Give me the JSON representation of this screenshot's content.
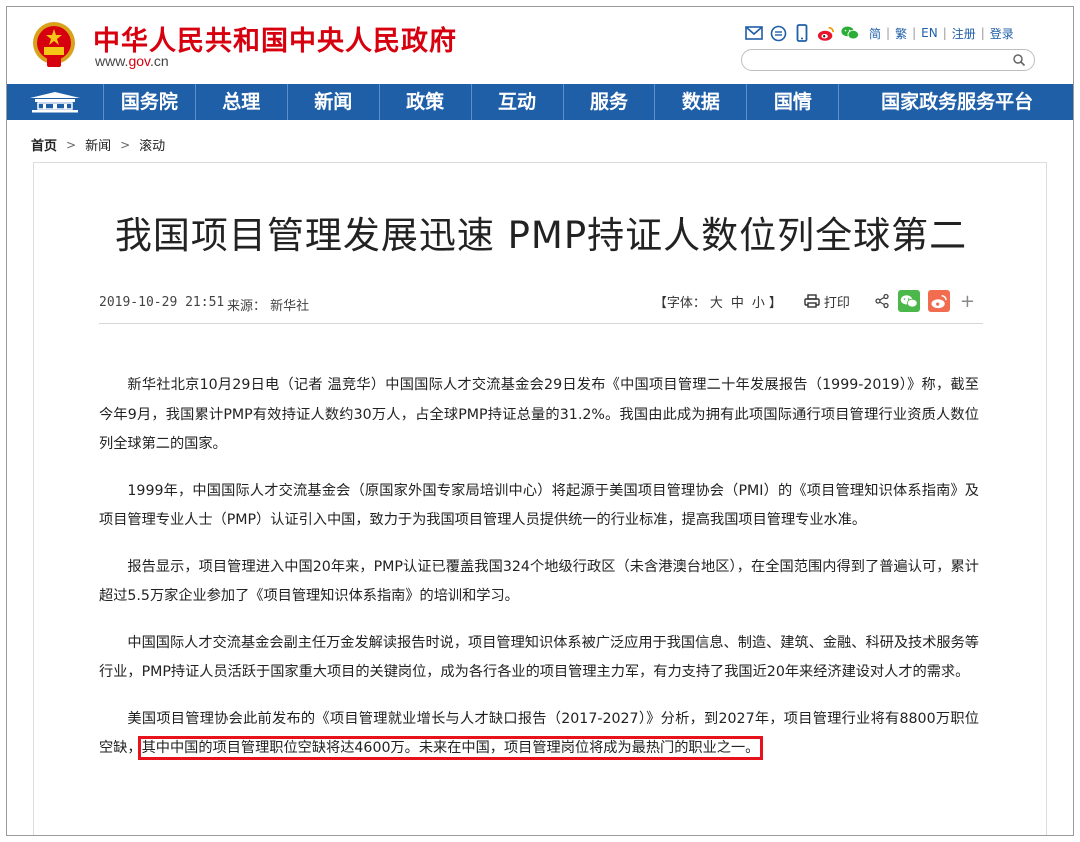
{
  "header": {
    "site_title": "中华人民共和国中央人民政府",
    "site_url_prefix": "www.",
    "site_url_gov": "gov",
    "site_url_suffix": ".cn",
    "top_links": [
      "简",
      "繁",
      "EN",
      "注册",
      "登录"
    ],
    "top_icons": [
      "mail-icon",
      "chat-icon",
      "mobile-icon",
      "weibo-icon",
      "wechat-icon"
    ],
    "search_placeholder": ""
  },
  "nav": {
    "items": [
      "国务院",
      "总理",
      "新闻",
      "政策",
      "互动",
      "服务",
      "数据",
      "国情",
      "国家政务服务平台"
    ]
  },
  "breadcrumb": {
    "home": "首页",
    "items": [
      "新闻",
      "滚动"
    ]
  },
  "article": {
    "title": "我国项目管理发展迅速 PMP持证人数位列全球第二",
    "date": "2019-10-29 21:51",
    "source": "来源： 新华社",
    "font_label_open": "【字体：",
    "font_large": "大",
    "font_medium": "中",
    "font_small": "小",
    "font_label_close": "】",
    "print_label": "打印",
    "paragraphs": [
      "新华社北京10月29日电（记者 温竞华）中国国际人才交流基金会29日发布《中国项目管理二十年发展报告（1999-2019）》称，截至今年9月，我国累计PMP有效持证人数约30万人，占全球PMP持证总量的31.2%。我国由此成为拥有此项国际通行项目管理行业资质人数位列全球第二的国家。",
      "1999年，中国国际人才交流基金会（原国家外国专家局培训中心）将起源于美国项目管理协会（PMI）的《项目管理知识体系指南》及项目管理专业人士（PMP）认证引入中国，致力于为我国项目管理人员提供统一的行业标准，提高我国项目管理专业水准。",
      "报告显示，项目管理进入中国20年来，PMP认证已覆盖我国324个地级行政区（未含港澳台地区），在全国范围内得到了普遍认可，累计超过5.5万家企业参加了《项目管理知识体系指南》的培训和学习。",
      "中国国际人才交流基金会副主任万金发解读报告时说，项目管理知识体系被广泛应用于我国信息、制造、建筑、金融、科研及技术服务等行业，PMP持证人员活跃于国家重大项目的关键岗位，成为各行各业的项目管理主力军，有力支持了我国近20年来经济建设对人才的需求。"
    ],
    "last_paragraph_lead": "美国项目管理协会此前发布的《项目管理就业增长与人才缺口报告（2017-2027）》分析，到2027年，项目管理行业将有8800万职位空缺，",
    "last_paragraph_highlight": "其中中国的项目管理职位空缺将达4600万。未来在中国，项目管理岗位将成为最热门的职业之一。"
  },
  "colors": {
    "brand_red": "#d7000f",
    "nav_blue": "#1f5fa8",
    "highlight_red": "#e8121c",
    "wechat_green": "#4cb74a",
    "weibo_orange": "#f26c4f"
  }
}
